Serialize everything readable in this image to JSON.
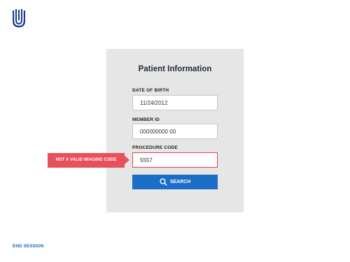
{
  "brand": {
    "logo_icon": "uhc-logo-icon",
    "color": "#1b3c8f"
  },
  "form": {
    "title": "Patient Information",
    "dob_label": "DATE OF BIRTH",
    "dob_value": "11/24/2012",
    "member_label": "MEMBER ID",
    "member_value": "000000000 00",
    "procedure_label": "PROCEDURE CODE",
    "procedure_value": "5557",
    "error_message": "NOT A VALID IMAGING CODE",
    "search_label": "SEARCH",
    "search_icon": "search-icon"
  },
  "footer": {
    "end_session_label": "END SESSION"
  },
  "colors": {
    "accent": "#1a6ec8",
    "error": "#e8505b",
    "card": "#e6e6e6"
  }
}
